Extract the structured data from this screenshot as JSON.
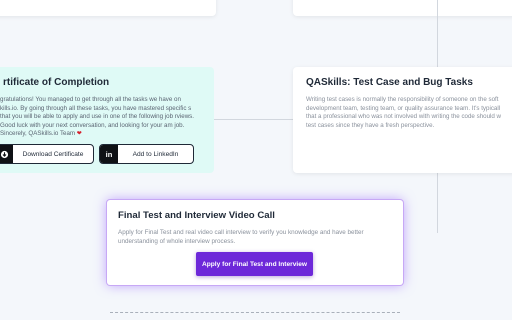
{
  "certificate": {
    "title": "rtificate of Completion",
    "text": "gratulations! You managed to get through all the tasks we have on kills.io. By going through all these tasks, you have mastered specific s that you will be able to apply and use in one of the following job rviews. Good luck with your next conversation, and looking for your am job. Sincerely, QASkills.io Team ",
    "heart": "❤",
    "download_label": "Download Certificate",
    "linkedin_label": "Add to LinkedIn",
    "linkedin_icon_text": "in"
  },
  "qa_tasks": {
    "title": "QASkills: Test Case and Bug Tasks",
    "lines": [
      "Writing test cases is normally the responsibility of someone on the soft",
      "development team, testing team, or quality assurance team. It's typicall",
      "that a professional who was not involved with writing the code should w",
      "test cases since they have a fresh perspective."
    ]
  },
  "final_test": {
    "title": "Final Test and Interview Video Call",
    "text": "Apply for Final Test and real video call interview to verify you knowledge and have better understanding of whole interview process.",
    "button_label": "Apply for Final Test and Interview"
  }
}
